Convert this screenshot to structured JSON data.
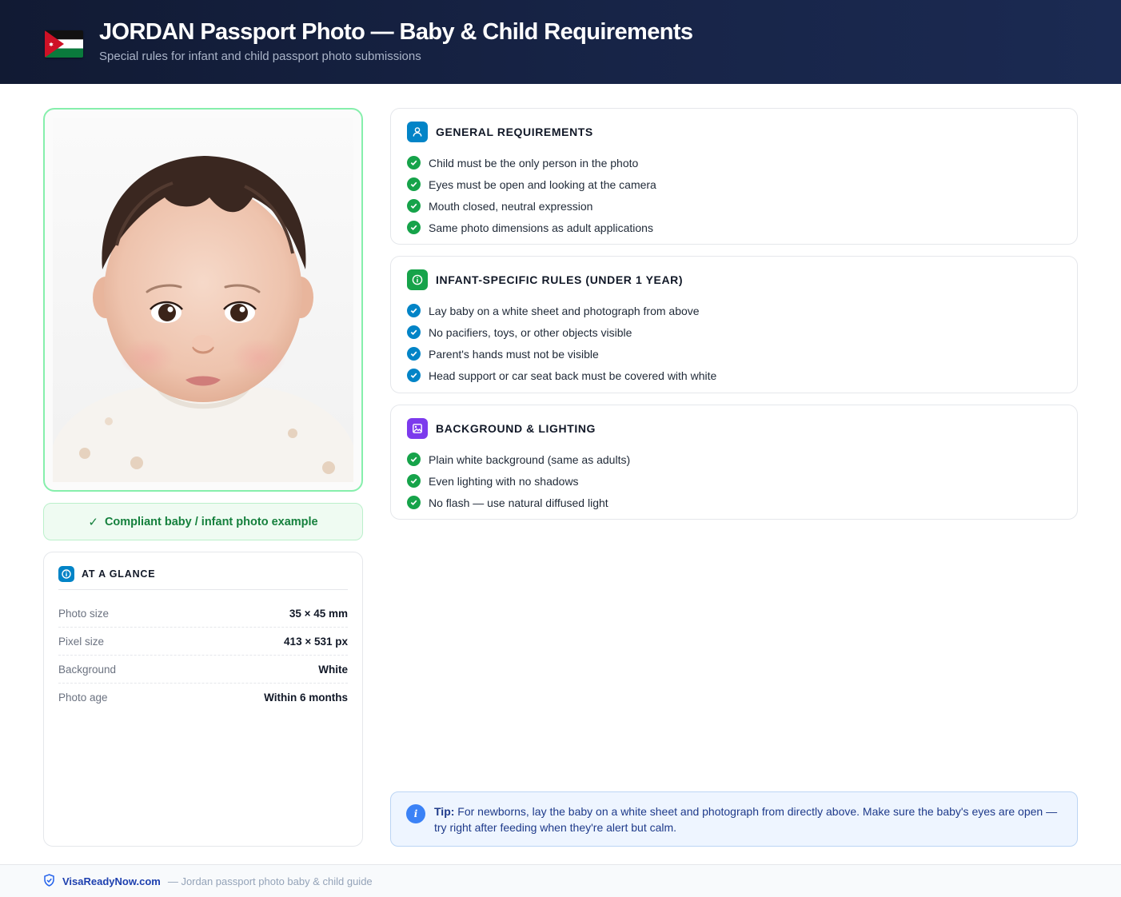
{
  "header": {
    "title": "JORDAN Passport Photo — Baby & Child Requirements",
    "subtitle": "Special rules for infant and child passport photo submissions",
    "flag_icon": "jordan-flag-icon"
  },
  "photo": {
    "caption": "Compliant baby / infant photo example",
    "caption_icon": "checkmark-icon"
  },
  "glance": {
    "title": "AT A GLANCE",
    "icon": "info-icon",
    "rows": [
      {
        "label": "Photo size",
        "value": "35 × 45 mm"
      },
      {
        "label": "Pixel size",
        "value": "413 × 531 px"
      },
      {
        "label": "Background",
        "value": "White"
      },
      {
        "label": "Photo age",
        "value": "Within 6 months"
      }
    ]
  },
  "sections": [
    {
      "title": "GENERAL REQUIREMENTS",
      "icon": "person-icon",
      "accent": "#0284c7",
      "bullet_color": "#16a34a",
      "items": [
        "Child must be the only person in the photo",
        "Eyes must be open and looking at the camera",
        "Mouth closed, neutral expression",
        "Same photo dimensions as adult applications"
      ]
    },
    {
      "title": "INFANT-SPECIFIC RULES (UNDER 1 YEAR)",
      "icon": "info-icon",
      "accent": "#16a34a",
      "bullet_color": "#0284c7",
      "items": [
        "Lay baby on a white sheet and photograph from above",
        "No pacifiers, toys, or other objects visible",
        "Parent's hands must not be visible",
        "Head support or car seat back must be covered with white"
      ]
    },
    {
      "title": "BACKGROUND & LIGHTING",
      "icon": "image-icon",
      "accent": "#7c3aed",
      "bullet_color": "#16a34a",
      "items": [
        "Plain white background (same as adults)",
        "Even lighting with no shadows",
        "No flash — use natural diffused light"
      ]
    }
  ],
  "tip": {
    "label": "Tip:",
    "text": " For newborns, lay the baby on a white sheet and photograph from directly above. Make sure the baby's eyes are open — try right after feeding when they're alert but calm."
  },
  "footer": {
    "brand": "VisaReadyNow.com",
    "description": "— Jordan passport photo baby & child guide"
  }
}
